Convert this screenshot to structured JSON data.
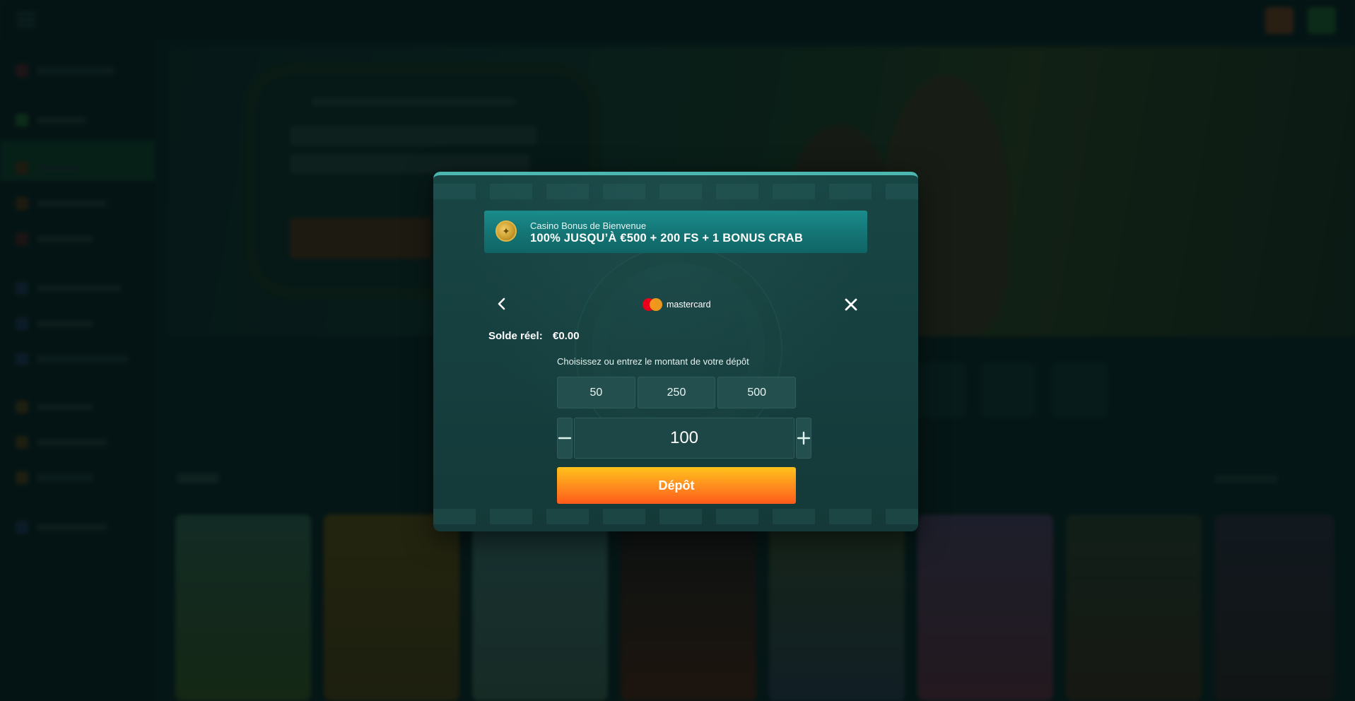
{
  "modal": {
    "bonus": {
      "subtitle": "Casino Bonus de Bienvenue",
      "title": "100% JUSQU’À €500 + 200 FS + 1 BONUS CRAB",
      "icon": "coin-icon"
    },
    "payment_method": {
      "label": "mastercard",
      "icon": "mastercard-logo"
    },
    "balance": {
      "label": "Solde réel:",
      "value": "€0.00"
    },
    "amount_hint": "Choisissez ou entrez le montant de votre dépôt",
    "presets": [
      "50",
      "250",
      "500"
    ],
    "amount_value": "100",
    "minus_symbol": "−",
    "plus_symbol": "+",
    "deposit_label": "Dépôt"
  },
  "colors": {
    "accent_teal": "#4bb7b0",
    "banner_teal": "#147474",
    "deposit_orange": "#ff8a1e",
    "modal_bg": "#163f3f"
  }
}
